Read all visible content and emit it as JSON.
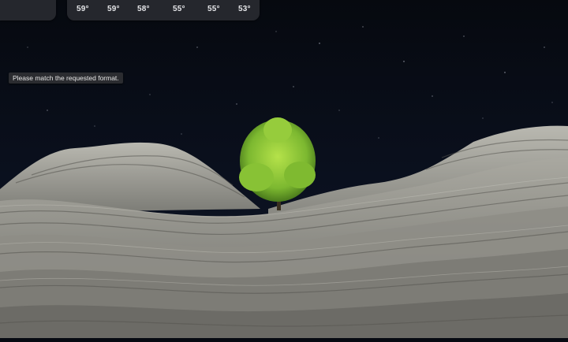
{
  "weather_widget": {
    "temps": [
      "59°",
      "59°",
      "58°",
      "55°",
      "55°",
      "53°"
    ]
  },
  "tooltip": {
    "text": "Please match the requested format."
  },
  "colors": {
    "sky": "#070a12",
    "widget_bg": "#28292f",
    "tree": "#8fc83a",
    "rock": "#a8a89f"
  }
}
